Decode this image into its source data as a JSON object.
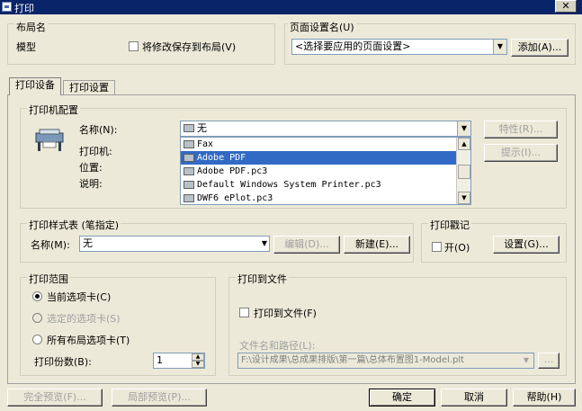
{
  "window": {
    "title": "打印"
  },
  "layout": {
    "label": "布局名",
    "value": "模型",
    "save_checkbox_label": "将修改保存到布局(V)"
  },
  "page_setup": {
    "label": "页面设置名(U)",
    "selected": "<选择要应用的页面设置>",
    "add_button": "添加(A)..."
  },
  "tabs": [
    {
      "label": "打印设备"
    },
    {
      "label": "打印设置"
    }
  ],
  "printer_config": {
    "group_label": "打印机配置",
    "name_label": "名称(N):",
    "name_value": "无",
    "printer_label": "打印机:",
    "location_label": "位置:",
    "desc_label": "说明:",
    "properties_button": "特性(R)...",
    "hints_button": "提示(I)...",
    "options": [
      "Fax",
      "Adobe PDF",
      "Adobe PDF.pc3",
      "Default Windows System Printer.pc3",
      "DWF6 ePlot.pc3"
    ]
  },
  "plot_style": {
    "group_label": "打印样式表 (笔指定)",
    "name_label": "名称(M):",
    "name_value": "无",
    "edit_button": "编辑(D)...",
    "new_button": "新建(E)..."
  },
  "plot_stamp": {
    "group_label": "打印戳记",
    "on_label": "开(O)",
    "settings_button": "设置(G)..."
  },
  "plot_range": {
    "group_label": "打印范围",
    "options": [
      {
        "label": "当前选项卡(C)"
      },
      {
        "label": "选定的选项卡(S)"
      },
      {
        "label": "所有布局选项卡(T)"
      }
    ],
    "copies_label": "打印份数(B):",
    "copies_value": "1"
  },
  "plot_to_file": {
    "group_label": "打印到文件",
    "checkbox_label": "打印到文件(F)",
    "path_label": "文件名和路径(L):",
    "path_value": "F:\\设计成果\\总成果排版\\第一篇\\总体布置图1-Model.plt",
    "browse_button": "..."
  },
  "footer": {
    "full_preview": "完全预览(F)...",
    "partial_preview": "局部预览(P)...",
    "ok": "确定",
    "cancel": "取消",
    "help": "帮助(H)"
  }
}
